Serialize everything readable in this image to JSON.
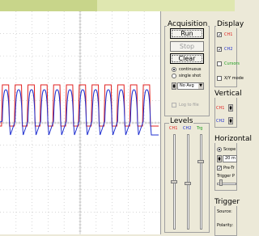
{
  "acquisition": {
    "title": "Acquisition",
    "run_label": "Run",
    "stop_label": "Stop",
    "clear_label": "Clear",
    "mode_continuous": "continuous",
    "mode_single_shot": "single shot",
    "averaging_value": "No Avg",
    "log_to_file": "Log to file",
    "continuous_selected": true
  },
  "display": {
    "title": "Display",
    "ch1": "CH1",
    "ch2": "CH2",
    "cursors": "Cursors",
    "xy_mode": "X/Y mode"
  },
  "vertical": {
    "title": "Vertical",
    "ch1": "CH1",
    "ch2": "CH2"
  },
  "levels": {
    "title": "Levels",
    "ch1": "CH1",
    "ch2": "CH2",
    "trg": "Trg"
  },
  "horizontal": {
    "title": "Horizontal",
    "scope_label": "Scope",
    "timebase_value": "20 m",
    "pretrigger_label": "Pre-Tr",
    "trigger_position_label": "Trigger P"
  },
  "trigger": {
    "title": "Trigger",
    "source_label": "Source:",
    "polarity_label": "Polarity:"
  },
  "colors": {
    "ch1": "#e02020",
    "ch2": "#2030d0",
    "trg": "#20a020",
    "grid": "#c8c8c8"
  },
  "waveform": {
    "pulse_count": 12,
    "ch1_high_fraction": 0.9,
    "ch2_high_fraction": 0.85,
    "ch2_low_fraction": 0.22
  }
}
